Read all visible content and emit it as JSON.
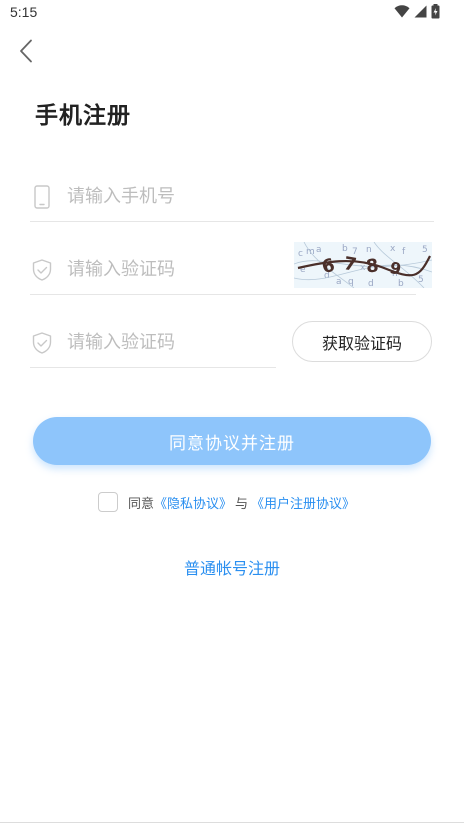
{
  "status_bar": {
    "time": "5:15",
    "icons": [
      "wifi-icon",
      "signal-icon",
      "battery-icon"
    ]
  },
  "header": {
    "back_icon": "chevron-left-icon",
    "title": "手机注册"
  },
  "form": {
    "phone": {
      "icon": "phone-icon",
      "placeholder": "请输入手机号",
      "value": ""
    },
    "captcha": {
      "icon": "shield-check-icon",
      "placeholder": "请输入验证码",
      "value": "",
      "image_text": "6789"
    },
    "sms_code": {
      "icon": "shield-check-icon",
      "placeholder": "请输入验证码",
      "value": "",
      "get_code_label": "获取验证码"
    },
    "submit_label": "同意协议并注册"
  },
  "agreement": {
    "checked": false,
    "prefix": "同意",
    "privacy_link": "《隐私协议》",
    "connector": "与",
    "user_link": "《用户注册协议》"
  },
  "alt_register_label": "普通帐号注册",
  "colors": {
    "accent": "#2a8ff0",
    "submit_bg": "#8ec5fb",
    "placeholder": "#bdbdbd",
    "divider": "#e6e6e6"
  }
}
